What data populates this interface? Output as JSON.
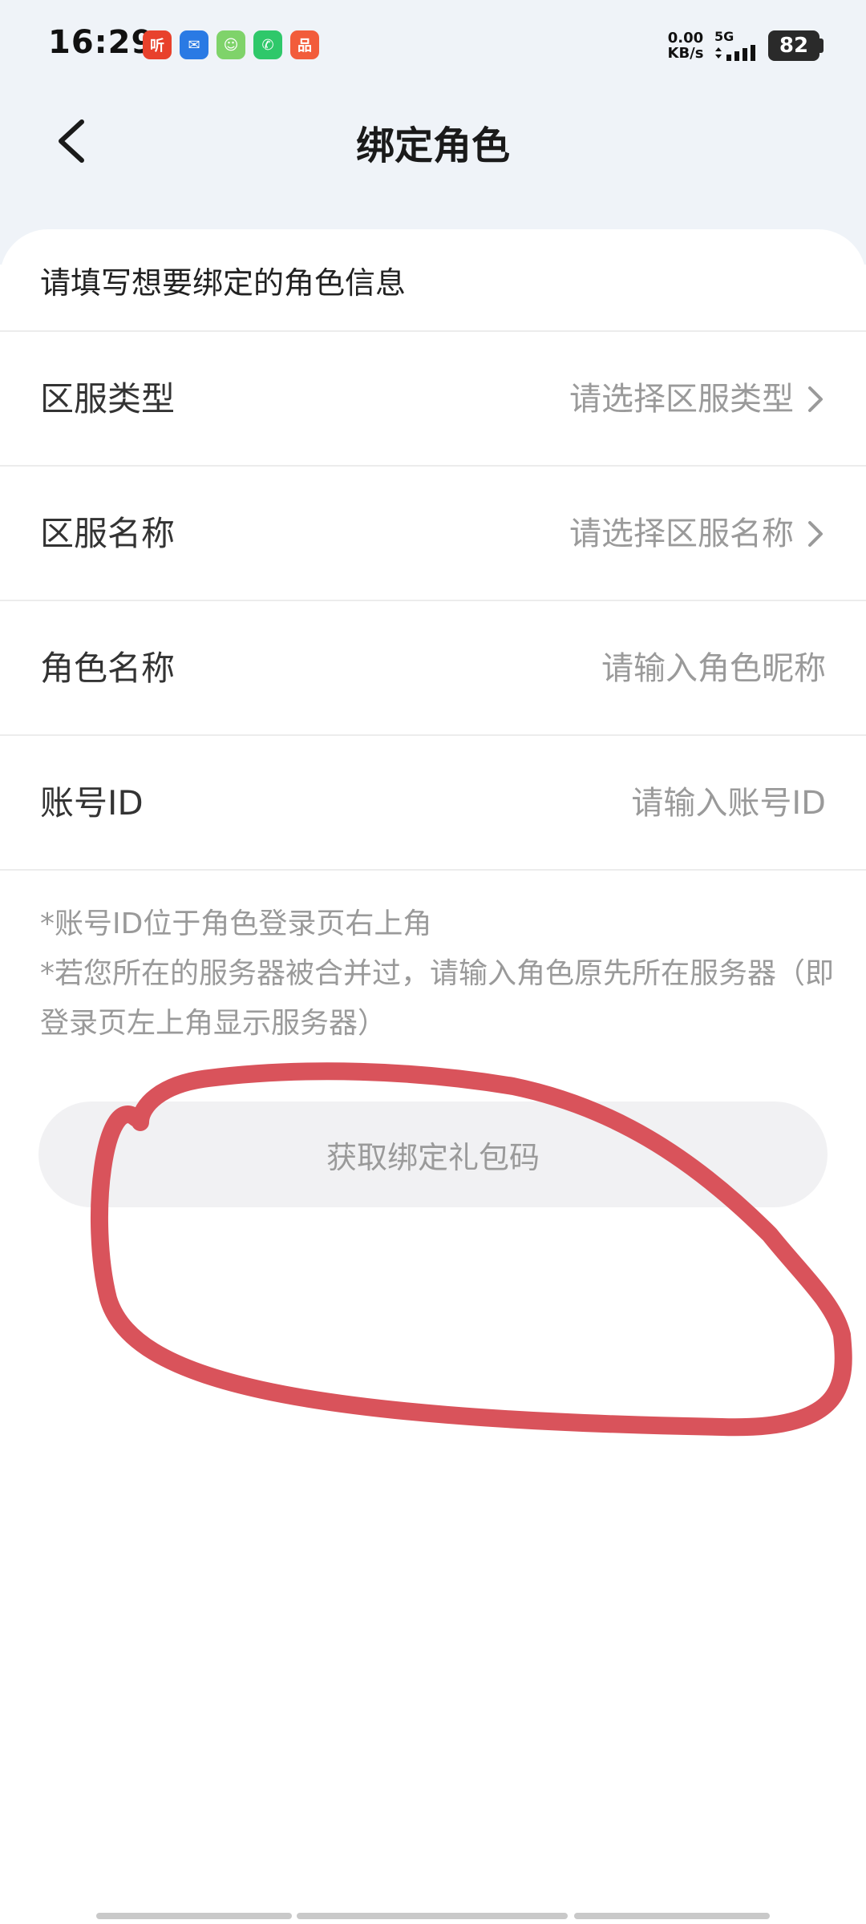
{
  "status_bar": {
    "time": "16:29",
    "net_speed_value": "0.00",
    "net_speed_unit": "KB/s",
    "network": "5G",
    "battery": "82",
    "app_icons": [
      {
        "name": "ting-app-icon",
        "glyph": "听",
        "color": "#e8412c"
      },
      {
        "name": "app-blue-icon",
        "glyph": "✉",
        "color": "#2a7ae4"
      },
      {
        "name": "app-green-face-icon",
        "glyph": "☺",
        "color": "#7fd36a"
      },
      {
        "name": "phone-app-icon",
        "glyph": "✆",
        "color": "#2fc86a"
      },
      {
        "name": "app-orange-icon",
        "glyph": "品",
        "color": "#f25c3b"
      }
    ]
  },
  "header": {
    "title": "绑定角色"
  },
  "form": {
    "intro": "请填写想要绑定的角色信息",
    "rows": [
      {
        "label": "区服类型",
        "placeholder": "请选择区服类型",
        "has_chevron": true
      },
      {
        "label": "区服名称",
        "placeholder": "请选择区服名称",
        "has_chevron": true
      },
      {
        "label": "角色名称",
        "placeholder": "请输入角色昵称",
        "has_chevron": false
      },
      {
        "label": "账号ID",
        "placeholder": "请输入账号ID",
        "has_chevron": false
      }
    ],
    "notes": [
      "*账号ID位于角色登录页右上角",
      "*若您所在的服务器被合并过，请输入角色原先所在服务器（即登录页左上角显示服务器）"
    ],
    "submit_label": "获取绑定礼包码"
  },
  "colors": {
    "accent_mark": "#d9535b",
    "header_bg": "#eff3f8",
    "placeholder": "#9a9a9a",
    "button_bg": "#f1f1f3"
  }
}
